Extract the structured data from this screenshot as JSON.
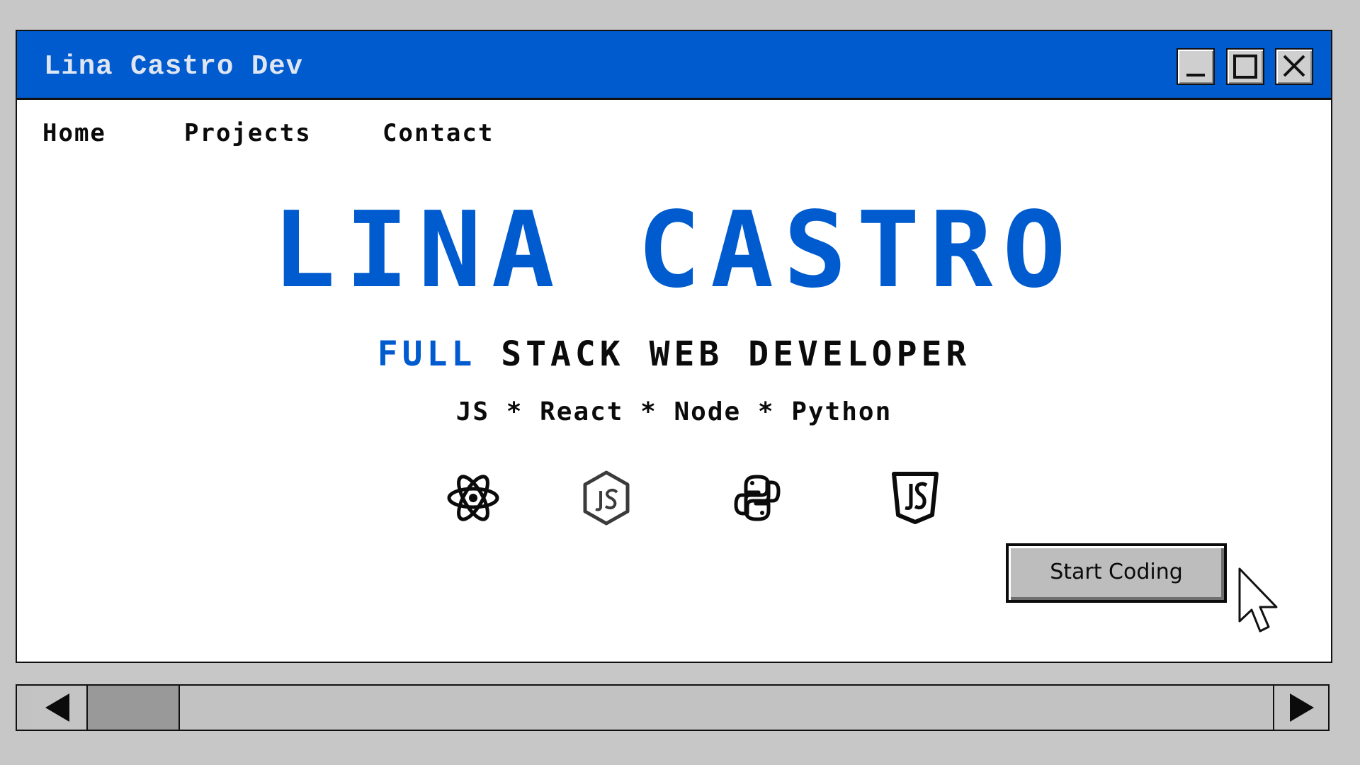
{
  "window": {
    "title": "Lina Castro Dev",
    "controls": {
      "minimize_icon": "minimize-icon",
      "maximize_icon": "maximize-icon",
      "close_icon": "close-icon"
    }
  },
  "nav": {
    "items": [
      {
        "label": "Home"
      },
      {
        "label": "Projects"
      },
      {
        "label": "Contact"
      }
    ]
  },
  "hero": {
    "name": "LINA CASTRO",
    "subtitle_accent": "FULL",
    "subtitle_rest": "STACK WEB DEVELOPER",
    "stack_line": "JS * React * Node * Python"
  },
  "tech_icons": [
    "react-icon",
    "nodejs-icon",
    "python-icon",
    "javascript-icon"
  ],
  "cta": {
    "label": "Start Coding"
  },
  "scrollbar": {
    "left_icon": "arrow-left-icon",
    "right_icon": "arrow-right-icon"
  },
  "colors": {
    "accent": "#005bcf",
    "background": "#c7c7c7",
    "window": "#ffffff",
    "text": "#0b0b0b"
  }
}
